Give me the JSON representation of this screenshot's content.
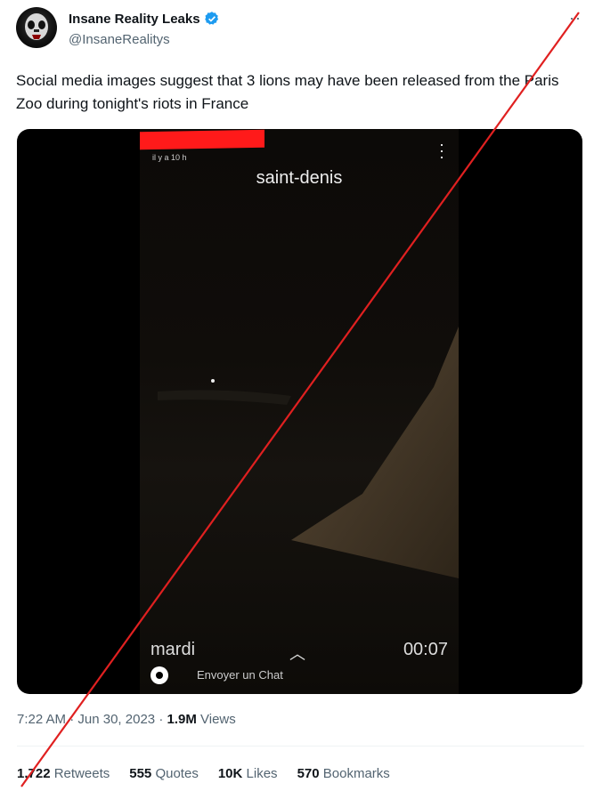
{
  "author": {
    "display_name": "Insane Reality Leaks",
    "handle": "@InsaneRealitys"
  },
  "more_glyph": "··",
  "tweet": {
    "text": "Social media images suggest that 3 lions may have been released from the Paris Zoo during tonight's riots in France"
  },
  "video": {
    "time_ago": "il y a 10 h",
    "location": "saint-denis",
    "day": "mardi",
    "timer": "00:07",
    "chat_prompt": "Envoyer un Chat"
  },
  "meta": {
    "time": "7:22 AM",
    "separator": "·",
    "date": "Jun 30, 2023",
    "views_count": "1.9M",
    "views_label": "Views"
  },
  "stats": {
    "retweets_count": "1,722",
    "retweets_label": "Retweets",
    "quotes_count": "555",
    "quotes_label": "Quotes",
    "likes_count": "10K",
    "likes_label": "Likes",
    "bookmarks_count": "570",
    "bookmarks_label": "Bookmarks"
  },
  "colors": {
    "verified_blue": "#1d9bf0",
    "cross_red": "#e02020",
    "redaction_red": "#ff1a1a"
  }
}
